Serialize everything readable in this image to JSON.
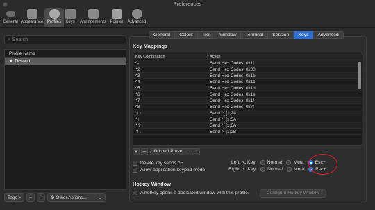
{
  "window": {
    "title": "Preferences"
  },
  "toolbar": {
    "items": [
      {
        "label": "General",
        "icon": "switch-icon",
        "color": "#7a7a7a"
      },
      {
        "label": "Appearance",
        "icon": "appearance-icon",
        "color": "#8a8a8a"
      },
      {
        "label": "Profiles",
        "icon": "profiles-icon",
        "color": "#9a9a9a"
      },
      {
        "label": "Keys",
        "icon": "keys-icon",
        "color": "#7d7d7d"
      },
      {
        "label": "Arrangements",
        "icon": "arrangements-icon",
        "color": "#8a8a8a"
      },
      {
        "label": "Pointer",
        "icon": "pointer-icon",
        "color": "#9a9a9a"
      },
      {
        "label": "Advanced",
        "icon": "gear-icon",
        "color": "#8a8a8a"
      }
    ]
  },
  "sidebar": {
    "search_placeholder": "Search",
    "list_header": "Profile Name",
    "profiles": [
      "★ Default"
    ]
  },
  "bottom": {
    "tags": "Tags >",
    "add": "+",
    "remove": "–",
    "other_actions": "⚙ Other Actions...",
    "dropdown": "⌄"
  },
  "tabs": [
    "General",
    "Colors",
    "Text",
    "Window",
    "Terminal",
    "Session",
    "Keys",
    "Advanced"
  ],
  "active_tab": "Keys",
  "key_mappings": {
    "title": "Key Mappings",
    "col_combo": "Key Combination",
    "col_action": "Action",
    "rows": [
      {
        "combo": "^-",
        "action": "Send Hex Codes: 0x1f"
      },
      {
        "combo": "^2",
        "action": "Send Hex Codes: 0x00"
      },
      {
        "combo": "^3",
        "action": "Send Hex Codes: 0x1b"
      },
      {
        "combo": "^4",
        "action": "Send Hex Codes: 0x1c"
      },
      {
        "combo": "^5",
        "action": "Send Hex Codes: 0x1d"
      },
      {
        "combo": "^6",
        "action": "Send Hex Codes: 0x1e"
      },
      {
        "combo": "^7",
        "action": "Send Hex Codes: 0x1f"
      },
      {
        "combo": "^8",
        "action": "Send Hex Codes: 0x7f"
      },
      {
        "combo": "⇧↑",
        "action": "Send ^[ [1;2A"
      },
      {
        "combo": "^↑",
        "action": "Send ^[ [1;5A"
      },
      {
        "combo": "^⇧↑",
        "action": "Send ^[ [1;6A"
      },
      {
        "combo": "⇧↓",
        "action": "Send ^[ [1;2B"
      }
    ],
    "add": "+",
    "remove": "–",
    "load_preset": "⚙ Load Preset...",
    "load_preset_arrow": "⌄"
  },
  "options": {
    "delete_sends_h": "Delete key sends ^H",
    "allow_keypad": "Allow application keypad mode",
    "left_key_label": "Left ⌥ Key:",
    "right_key_label": "Right ⌥ Key:",
    "normal": "Normal",
    "meta": "Meta",
    "esc": "Esc+"
  },
  "hotkey": {
    "title": "Hotkey Window",
    "checkbox": "A hotkey opens a dedicated window with this profile.",
    "configure_button": "Configure Hotkey Window"
  },
  "colors": {
    "accent": "#2d6fd3",
    "highlight_circle": "#e0202a"
  }
}
